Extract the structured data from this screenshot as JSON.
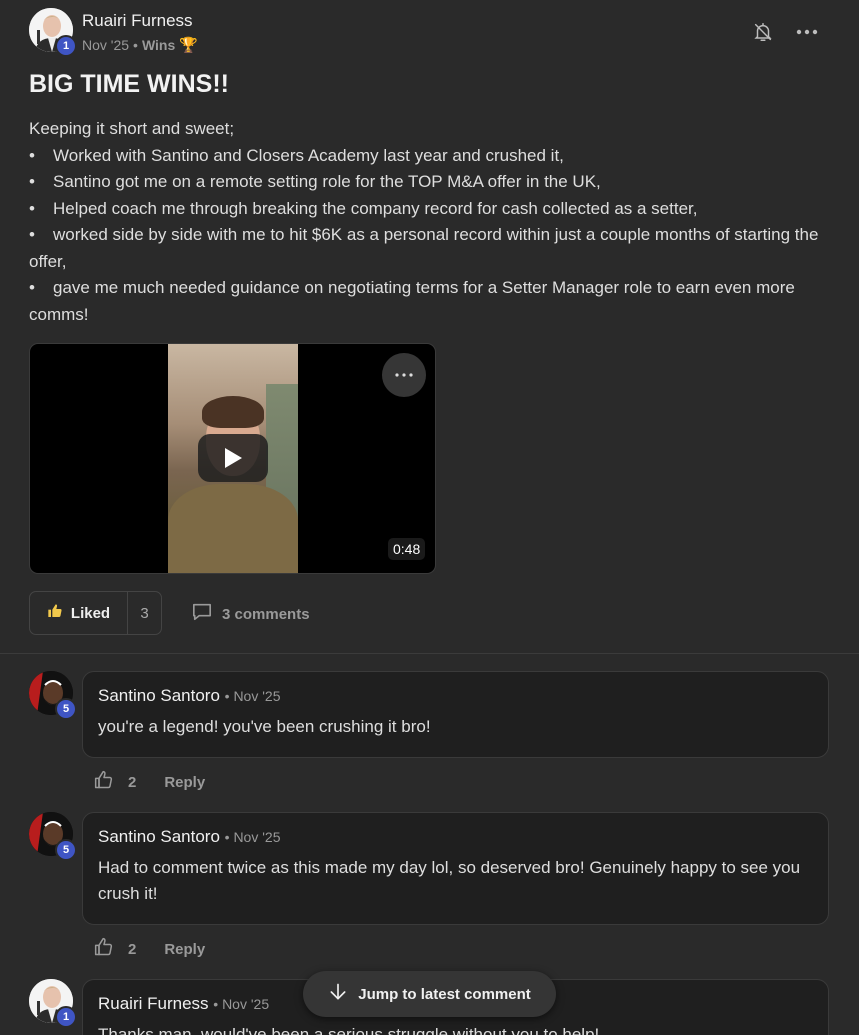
{
  "post": {
    "author": "Ruairi Furness",
    "author_level": "1",
    "date": "Nov '25",
    "separator": "•",
    "category": "Wins",
    "category_emoji": "🏆",
    "title": "BIG TIME WINS!!",
    "intro": "Keeping it short and sweet;",
    "bullets": [
      "Worked with Santino and Closers Academy last year and crushed it,",
      "Santino got me on a remote setting role for the TOP M&A offer in the UK,",
      "Helped coach me through breaking the company record for cash collected as a setter,",
      "worked side by side with me to hit $6K as a personal record within just a couple months of starting the offer,",
      "gave me much needed guidance on negotiating terms for a Setter Manager role to earn even more comms!"
    ],
    "video": {
      "duration": "0:48",
      "more_icon": "ellipsis-icon"
    },
    "liked_label": "Liked",
    "like_count": "3",
    "comments_label": "3 comments"
  },
  "comments": [
    {
      "author": "Santino Santoro",
      "level": "5",
      "date": "• Nov '25",
      "text": "you're a legend! you've been crushing it bro!",
      "likes": "2",
      "reply_label": "Reply"
    },
    {
      "author": "Santino Santoro",
      "level": "5",
      "date": "• Nov '25",
      "text": "Had to comment twice as this made my day lol, so deserved bro! Genuinely happy to see you crush it!",
      "likes": "2",
      "reply_label": "Reply"
    },
    {
      "author": "Ruairi Furness",
      "level": "1",
      "date": "• Nov '25",
      "text": "Thanks man, would've been a serious struggle without you to help!"
    }
  ],
  "jump_label": "Jump to latest comment",
  "colors": {
    "background": "#2a2a2a",
    "bubble": "#1f1f1f",
    "level_badge": "#3f55c4"
  }
}
